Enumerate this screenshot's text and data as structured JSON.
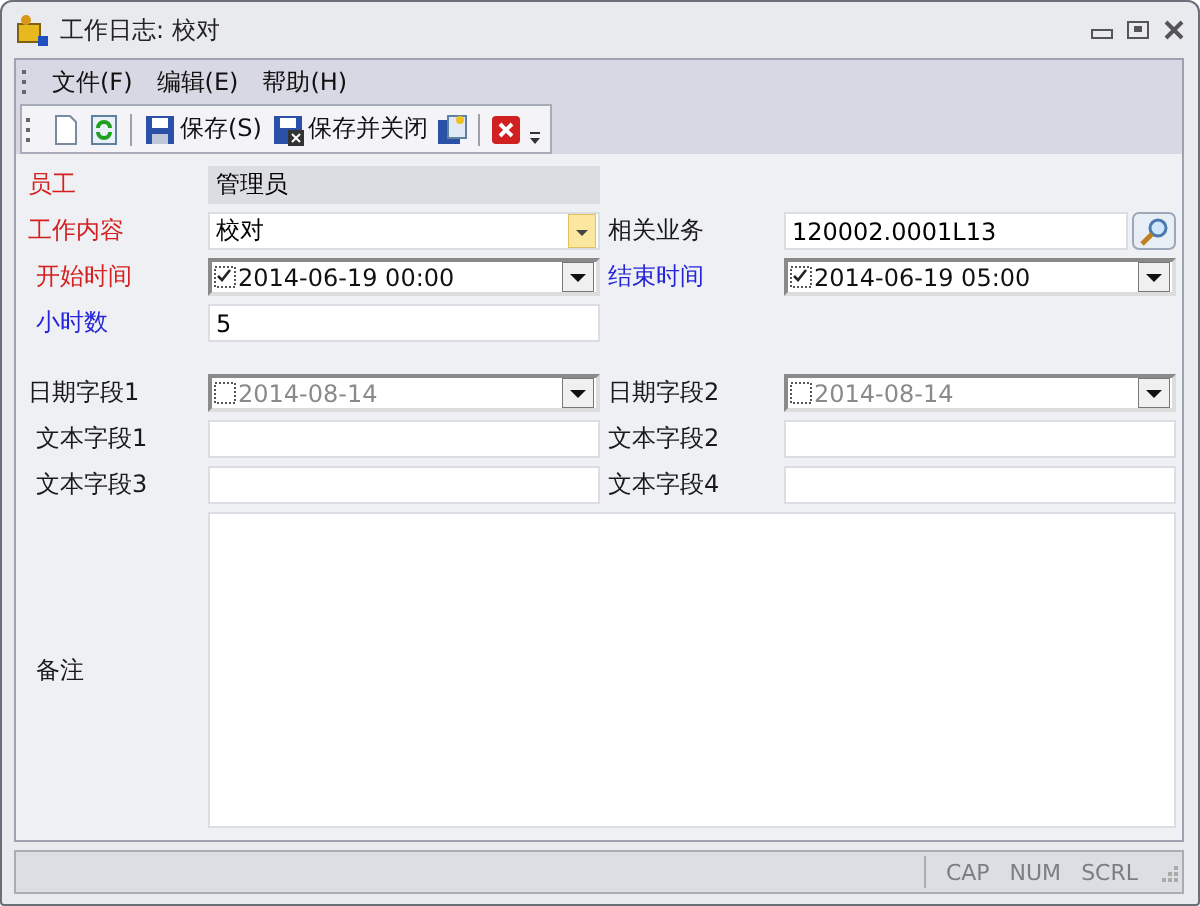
{
  "window": {
    "title": "工作日志: 校对"
  },
  "menu": [
    {
      "label": "文件(F)"
    },
    {
      "label": "编辑(E)"
    },
    {
      "label": "帮助(H)"
    }
  ],
  "toolbar": [
    {
      "kind": "new"
    },
    {
      "kind": "refresh"
    },
    {
      "kind": "separator"
    },
    {
      "kind": "save",
      "label": "保存(S)"
    },
    {
      "kind": "save-close",
      "label": "保存并关闭"
    },
    {
      "kind": "copy"
    },
    {
      "kind": "separator"
    },
    {
      "kind": "delete"
    },
    {
      "kind": "overflow"
    }
  ],
  "sections": [
    {
      "rows": [
        [
          {
            "label": "员工",
            "color": "#d42020",
            "kind": "readonly",
            "value": "管理员"
          }
        ],
        [
          {
            "label": "工作内容",
            "color": "#d42020",
            "kind": "combo",
            "value": "校对"
          },
          {
            "label": "相关业务",
            "color": "#1a1a1a",
            "kind": "lookup",
            "value": "120002.0001L13"
          }
        ],
        [
          {
            "label": "开始时间",
            "color": "#d42020",
            "kind": "date",
            "checked": true,
            "value": "2014-06-19 00:00"
          },
          {
            "label": "结束时间",
            "color": "#2424d8",
            "kind": "date",
            "checked": true,
            "value": "2014-06-19 05:00"
          }
        ],
        [
          {
            "label": "小时数",
            "color": "#2424d8",
            "kind": "text",
            "value": "5"
          }
        ]
      ]
    },
    {
      "rows": [
        [
          {
            "label": "日期字段1",
            "color": "#1a1a1a",
            "kind": "date",
            "checked": false,
            "value": "2014-08-14"
          },
          {
            "label": "日期字段2",
            "color": "#1a1a1a",
            "kind": "date",
            "checked": false,
            "value": "2014-08-14"
          }
        ],
        [
          {
            "label": "文本字段1",
            "color": "#1a1a1a",
            "kind": "text"
          },
          {
            "label": "文本字段2",
            "color": "#1a1a1a",
            "kind": "text"
          }
        ],
        [
          {
            "label": "文本字段3",
            "color": "#1a1a1a",
            "kind": "text"
          },
          {
            "label": "文本字段4",
            "color": "#1a1a1a",
            "kind": "text"
          }
        ],
        [
          {
            "label": "备注",
            "color": "#1a1a1a",
            "kind": "memo"
          }
        ]
      ]
    }
  ],
  "status_bar": [
    {
      "label": "CAP",
      "on": false
    },
    {
      "label": "NUM",
      "on": false
    },
    {
      "label": "SCRL",
      "on": false
    }
  ]
}
